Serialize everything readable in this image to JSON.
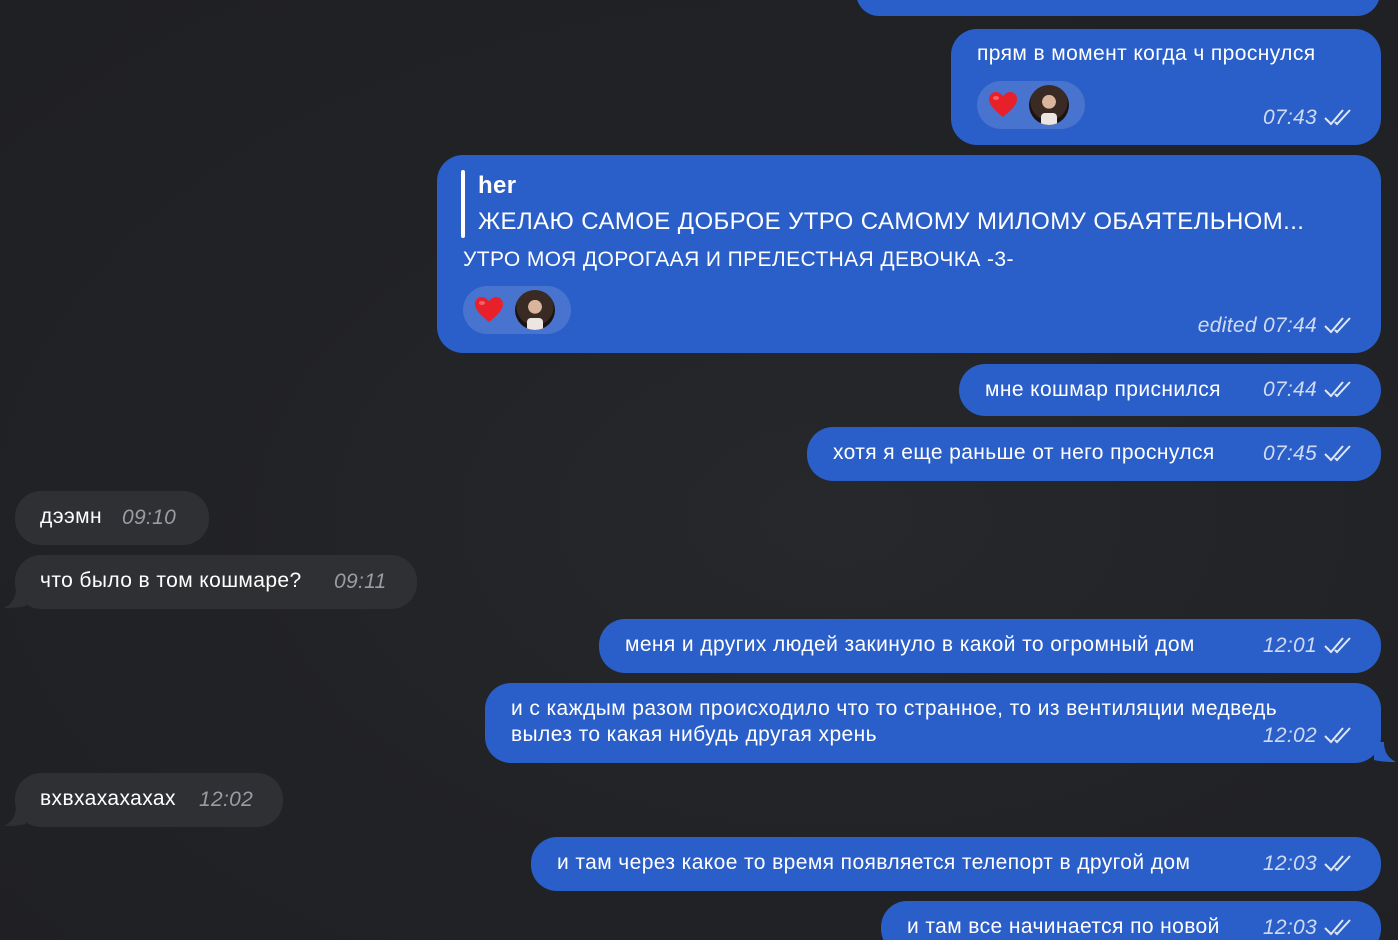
{
  "messages": [
    {
      "text": "прям в момент когда ч проснулся",
      "time": "07:43"
    },
    {
      "reply_author": "her",
      "reply_text": "ЖЕЛАЮ САМОЕ ДОБРОЕ УТРО САМОМУ МИЛОМУ ОБАЯТЕЛЬНОМ...",
      "text": "УТРО МОЯ ДОРОГААЯ И ПРЕЛЕСТНАЯ ДЕВОЧКА -3-",
      "time": "edited 07:44"
    },
    {
      "text": "мне кошмар приснился",
      "time": "07:44"
    },
    {
      "text": "хотя я еще раньше от него проснулся",
      "time": "07:45"
    },
    {
      "text": "дээмн",
      "time": "09:10"
    },
    {
      "text": "что было в том кошмаре?",
      "time": "09:11"
    },
    {
      "text": "меня и других людей закинуло в какой то огромный дом",
      "time": "12:01"
    },
    {
      "text_line1": "и с каждым разом происходило что то странное, то из вентиляции медведь",
      "text_line2": "вылез то какая нибудь другая хрень",
      "time": "12:02"
    },
    {
      "text": "вхвхахахахах",
      "time": "12:02"
    },
    {
      "text": "и там через какое то время появляется телепорт в другой дом",
      "time": "12:03"
    },
    {
      "text": "и там все начинается по новой",
      "time": "12:03"
    }
  ],
  "colors": {
    "background": "#212226",
    "outgoing_bubble": "#2a5ec8",
    "incoming_bubble": "#2f3034",
    "heart": "#e8202a"
  },
  "icons": {
    "read_status": "double-check-icon",
    "reaction": "heart-icon",
    "reactor": "avatar"
  }
}
